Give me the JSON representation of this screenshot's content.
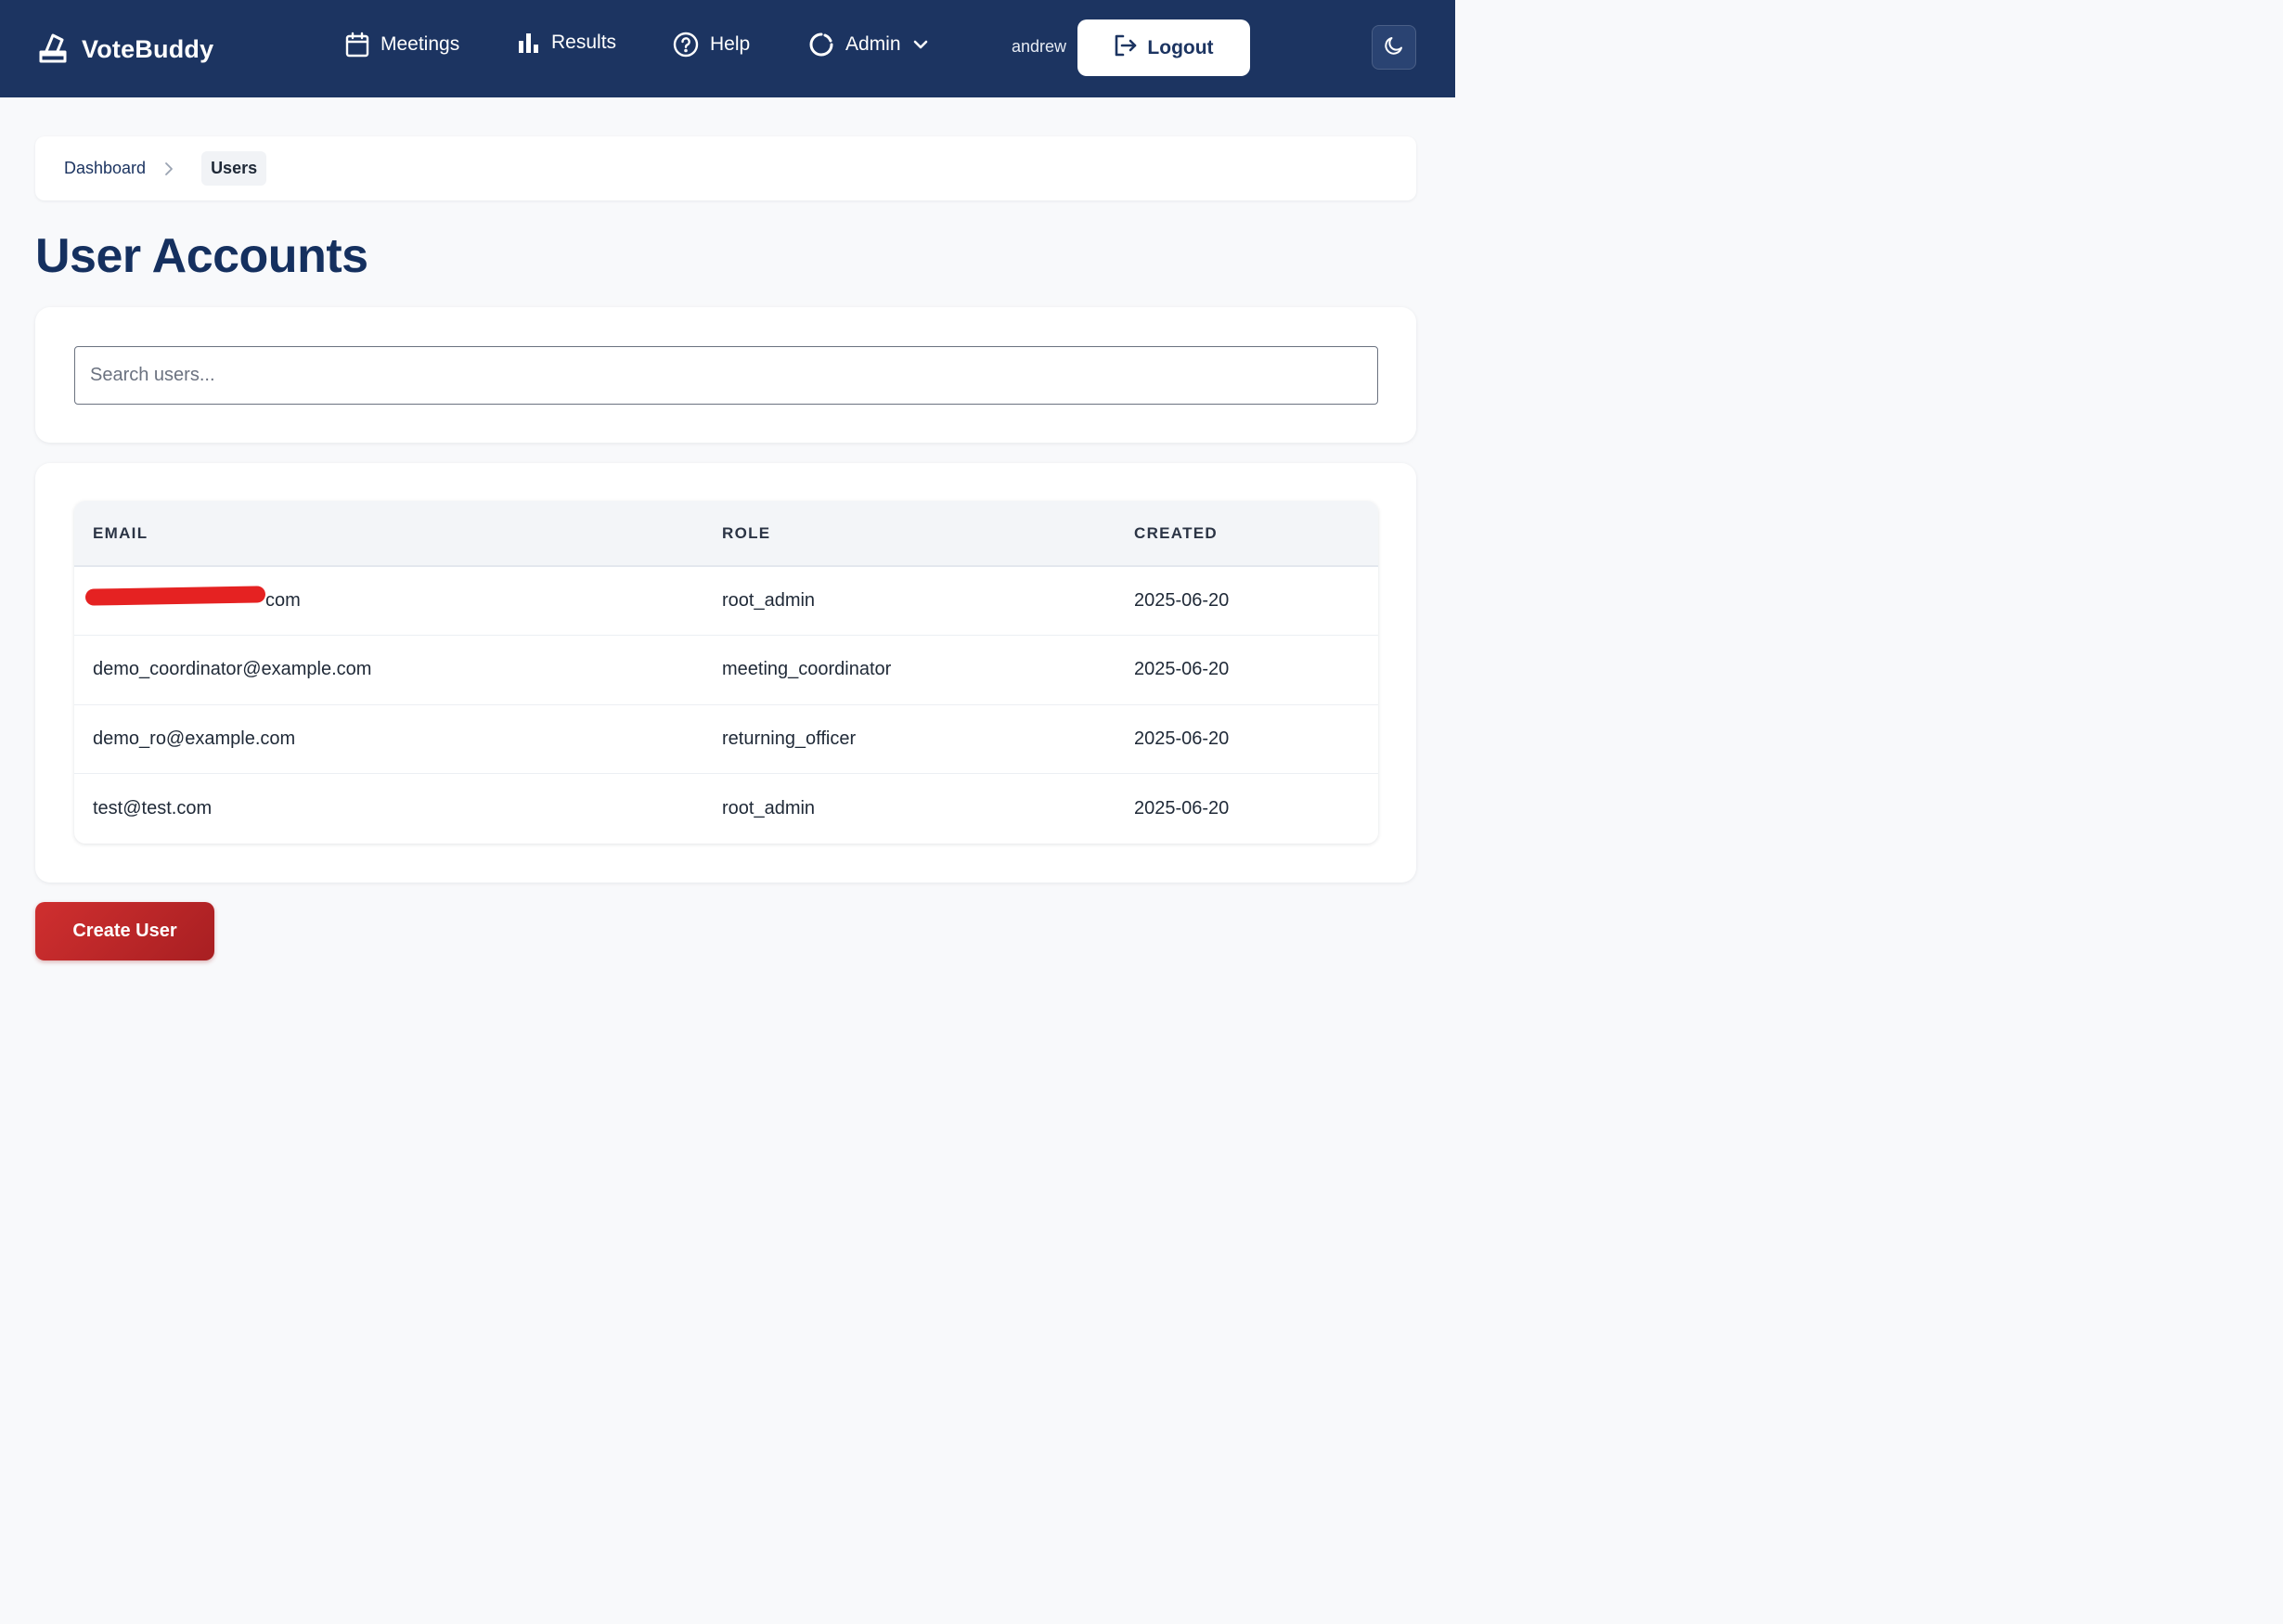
{
  "app": {
    "name": "VoteBuddy",
    "logo_icon": "ballot-box-icon"
  },
  "nav": {
    "items": [
      {
        "label": "Meetings",
        "icon": "calendar-icon"
      },
      {
        "label": "Results",
        "icon": "bar-chart-icon"
      },
      {
        "label": "Help",
        "icon": "help-circle-icon"
      },
      {
        "label": "Admin",
        "icon": "admin-circle-icon",
        "has_dropdown": true
      }
    ],
    "user": "andrew",
    "logout_label": "Logout",
    "theme_toggle_icon": "moon-icon"
  },
  "breadcrumb": {
    "items": [
      "Dashboard",
      "Users"
    ]
  },
  "page": {
    "title": "User Accounts"
  },
  "search": {
    "placeholder": "Search users...",
    "value": ""
  },
  "users_table": {
    "columns": [
      "EMAIL",
      "ROLE",
      "CREATED"
    ],
    "rows": [
      {
        "email": "com",
        "email_redacted": true,
        "role": "root_admin",
        "created": "2025-06-20"
      },
      {
        "email": "demo_coordinator@example.com",
        "role": "meeting_coordinator",
        "created": "2025-06-20"
      },
      {
        "email": "demo_ro@example.com",
        "role": "returning_officer",
        "created": "2025-06-20"
      },
      {
        "email": "test@test.com",
        "role": "root_admin",
        "created": "2025-06-20"
      }
    ]
  },
  "actions": {
    "create_user_label": "Create User"
  },
  "colors": {
    "header_bg": "#1c3461",
    "title": "#15305f",
    "create_button": "#c0282b",
    "redaction": "#e52222"
  }
}
